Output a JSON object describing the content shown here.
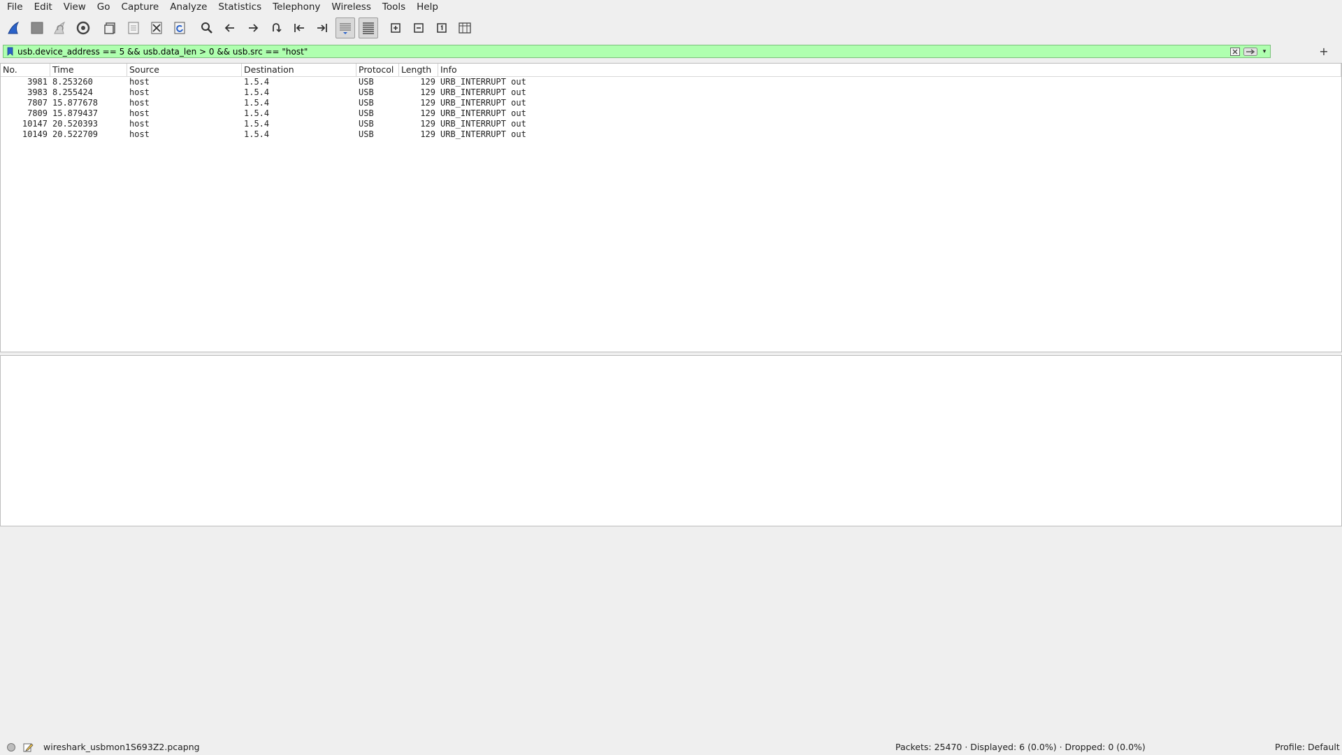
{
  "menu": [
    "File",
    "Edit",
    "View",
    "Go",
    "Capture",
    "Analyze",
    "Statistics",
    "Telephony",
    "Wireless",
    "Tools",
    "Help"
  ],
  "toolbar": {
    "icons": [
      "shark-fin-icon",
      "stop-square-icon",
      "restart-fin-icon",
      "gear-options-icon",
      "open-file-icon",
      "save-file-icon",
      "close-file-icon",
      "reload-icon",
      "search-icon",
      "arrow-left-icon",
      "arrow-right-icon",
      "go-to-packet-icon",
      "first-packet-icon",
      "last-packet-icon",
      "autoscroll-icon",
      "colorize-icon",
      "zoom-in-icon",
      "zoom-out-icon",
      "normal-size-icon",
      "resize-columns-icon"
    ]
  },
  "filter": {
    "value": "usb.device_address == 5 && usb.data_len > 0 && usb.src == \"host\"",
    "background": "#afffaf"
  },
  "packet_list": {
    "columns": [
      "No.",
      "Time",
      "Source",
      "Destination",
      "Protocol",
      "Length",
      "Info"
    ],
    "rows": [
      {
        "no": "3981",
        "time": "8.253260",
        "src": "host",
        "dst": "1.5.4",
        "proto": "USB",
        "len": "129",
        "info": "URB_INTERRUPT out"
      },
      {
        "no": "3983",
        "time": "8.255424",
        "src": "host",
        "dst": "1.5.4",
        "proto": "USB",
        "len": "129",
        "info": "URB_INTERRUPT out"
      },
      {
        "no": "7807",
        "time": "15.877678",
        "src": "host",
        "dst": "1.5.4",
        "proto": "USB",
        "len": "129",
        "info": "URB_INTERRUPT out"
      },
      {
        "no": "7809",
        "time": "15.879437",
        "src": "host",
        "dst": "1.5.4",
        "proto": "USB",
        "len": "129",
        "info": "URB_INTERRUPT out"
      },
      {
        "no": "10147",
        "time": "20.520393",
        "src": "host",
        "dst": "1.5.4",
        "proto": "USB",
        "len": "129",
        "info": "URB_INTERRUPT out"
      },
      {
        "no": "10149",
        "time": "20.522709",
        "src": "host",
        "dst": "1.5.4",
        "proto": "USB",
        "len": "129",
        "info": "URB_INTERRUPT out"
      }
    ]
  },
  "status": {
    "file": "wireshark_usbmon1S693Z2.pcapng",
    "packets": "Packets: 25470 · Displayed: 6 (0.0%) · Dropped: 0 (0.0%)",
    "profile": "Profile: Default"
  }
}
